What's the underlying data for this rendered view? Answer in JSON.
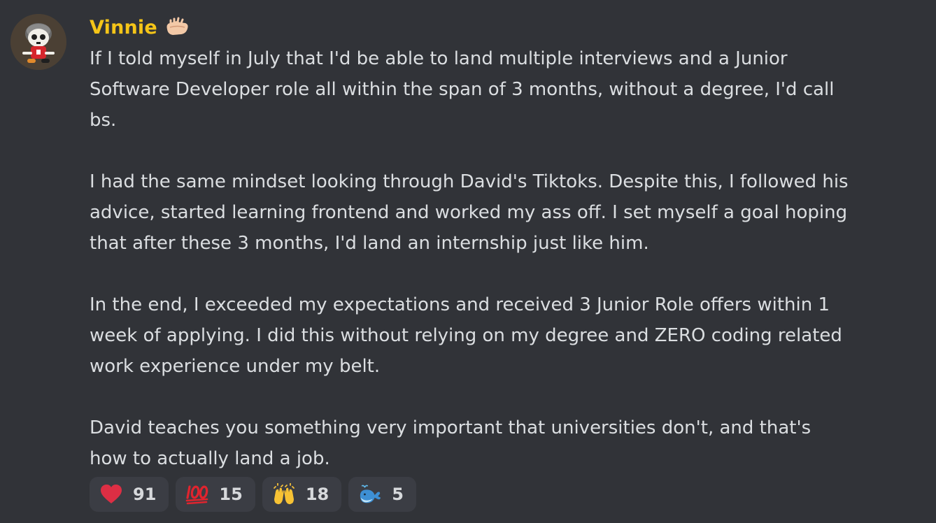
{
  "message": {
    "author": "Vinnie",
    "paragraphs": [
      [
        "If I told myself in July that I'd be able to land multiple interviews and a Junior",
        "Software Developer role all within the span of 3 months, without a degree, I'd call",
        "bs."
      ],
      [
        "I had the same mindset looking through David's Tiktoks. Despite this, I followed his",
        "advice, started learning frontend and worked my ass off. I set myself a goal hoping",
        "that after these 3 months, I'd land an internship just like him."
      ],
      [
        "In the end, I exceeded my expectations and received 3 Junior Role offers within 1",
        "week of applying. I did this without relying on my degree and ZERO coding related",
        "work experience under my belt."
      ],
      [
        "David teaches you something very important that universities don't, and that's",
        "how to actually land a job."
      ]
    ],
    "reactions": [
      {
        "emoji": "heart-icon",
        "count": "91"
      },
      {
        "emoji": "hundred-points-icon",
        "count": "15"
      },
      {
        "emoji": "raising-hands-icon",
        "count": "18"
      },
      {
        "emoji": "whale-icon",
        "count": "5"
      }
    ]
  },
  "colors": {
    "background": "#313338",
    "username": "#f5c518",
    "text": "#dbdee1",
    "reaction_bg": "#3b3d44"
  }
}
